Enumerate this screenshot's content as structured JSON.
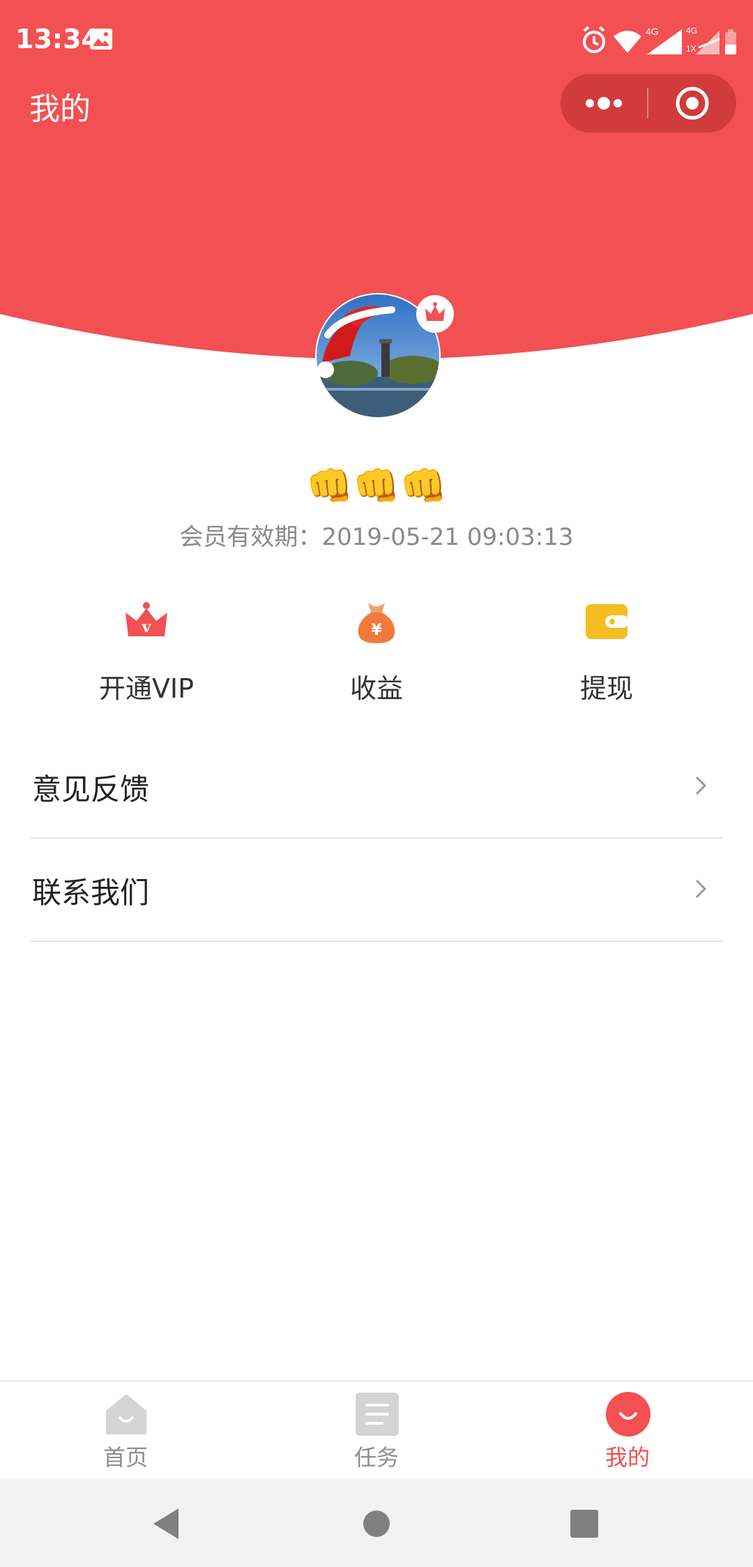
{
  "status_bar": {
    "time": "13:34",
    "network_label": "4G",
    "network_label_2": "4G",
    "sim_label": "1X"
  },
  "header": {
    "title": "我的",
    "accent_color": "#f25052"
  },
  "profile": {
    "nickname": "👊👊👊",
    "membership_expiry": "会员有效期：2019-05-21 09:03:13"
  },
  "actions": [
    {
      "label": "开通VIP",
      "icon": "crown-vip-icon"
    },
    {
      "label": "收益",
      "icon": "money-bag-icon"
    },
    {
      "label": "提现",
      "icon": "wallet-icon"
    }
  ],
  "menu": [
    {
      "label": "意见反馈"
    },
    {
      "label": "联系我们"
    }
  ],
  "tabbar": {
    "tabs": [
      {
        "label": "首页",
        "icon": "home-icon",
        "active": false
      },
      {
        "label": "任务",
        "icon": "task-list-icon",
        "active": false
      },
      {
        "label": "我的",
        "icon": "profile-icon",
        "active": true
      }
    ]
  }
}
